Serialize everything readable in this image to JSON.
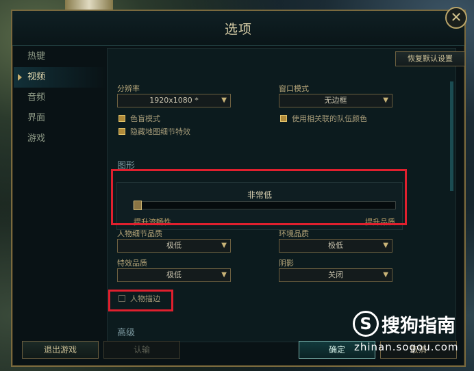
{
  "window": {
    "title": "选项",
    "close_symbol": "✕"
  },
  "sidebar": {
    "items": [
      {
        "label": "热键",
        "active": false
      },
      {
        "label": "视频",
        "active": true
      },
      {
        "label": "音频",
        "active": false
      },
      {
        "label": "界面",
        "active": false
      },
      {
        "label": "游戏",
        "active": false
      }
    ]
  },
  "panel": {
    "restore_defaults_label": "恢复默认设置",
    "resolution": {
      "label": "分辨率",
      "value": "1920x1080 *"
    },
    "window_mode": {
      "label": "窗口模式",
      "value": "无边框"
    },
    "checkboxes_left": [
      {
        "label": "色盲模式",
        "checked": true
      },
      {
        "label": "隐藏地图细节特效",
        "checked": true
      }
    ],
    "checkbox_right": {
      "label": "使用相关联的队伍颜色",
      "checked": true
    },
    "graphics_title": "图形",
    "quality": {
      "level_label": "非常低",
      "slider_fraction": 0.0,
      "left_label": "提升流畅性",
      "right_label": "提升品质"
    },
    "character_quality": {
      "label": "人物细节品质",
      "value": "极低"
    },
    "environment_quality": {
      "label": "环境品质",
      "value": "极低"
    },
    "effects_quality": {
      "label": "特效品质",
      "value": "极低"
    },
    "shadows": {
      "label": "阴影",
      "value": "关闭"
    },
    "character_outline": {
      "label": "人物描边",
      "checked": false
    },
    "advanced_title": "高级"
  },
  "footer": {
    "quit_label": "退出游戏",
    "confess_label": "认输",
    "ok_label": "确定",
    "cancel_label": "取消"
  },
  "watermark": {
    "logo_letter": "S",
    "name": "搜狗指南",
    "url": "zhinan.sogou.com"
  },
  "colors": {
    "highlight_red": "#e0202e",
    "gold": "#c9b071",
    "panel_bg": "#0c1b1e"
  }
}
